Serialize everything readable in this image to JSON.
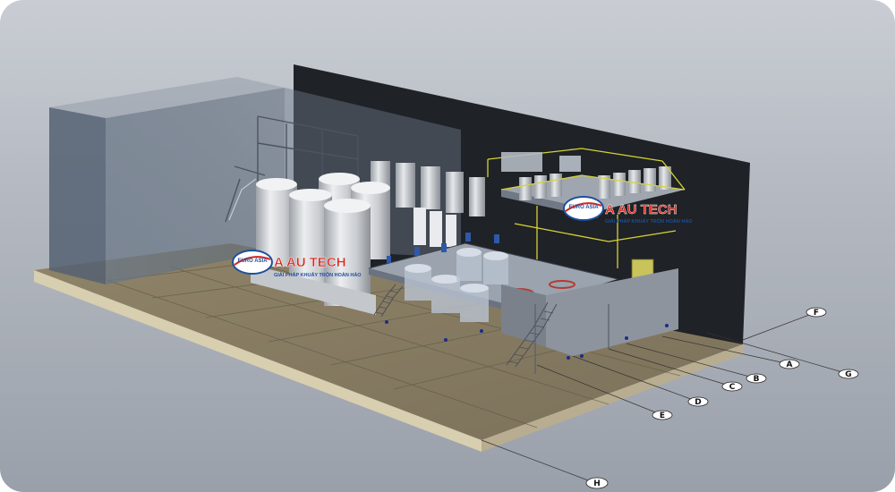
{
  "watermarks": [
    {
      "brand": "A AU TECH",
      "tagline": "GIẢI PHÁP KHUẤY TRỘN HOÀN HẢO",
      "emblem": "EURO ASIA"
    },
    {
      "brand": "A AU TECH",
      "tagline": "GIẢI PHÁP KHUẤY TRỘN HOÀN HẢO",
      "emblem": "EURO ASIA"
    }
  ],
  "grid_labels": {
    "right": [
      "A",
      "B",
      "C",
      "D",
      "E",
      "F",
      "G"
    ],
    "bottom": "H"
  },
  "colors": {
    "background": "#aeb3bb",
    "floor": "#8b7e62",
    "walls": "#5f6d7e",
    "back_wall": "#1f2226",
    "tanks": "#d7d9dc",
    "railing": "#d6d335",
    "logo_red": "#d7261e",
    "logo_blue": "#1c4e9c"
  }
}
